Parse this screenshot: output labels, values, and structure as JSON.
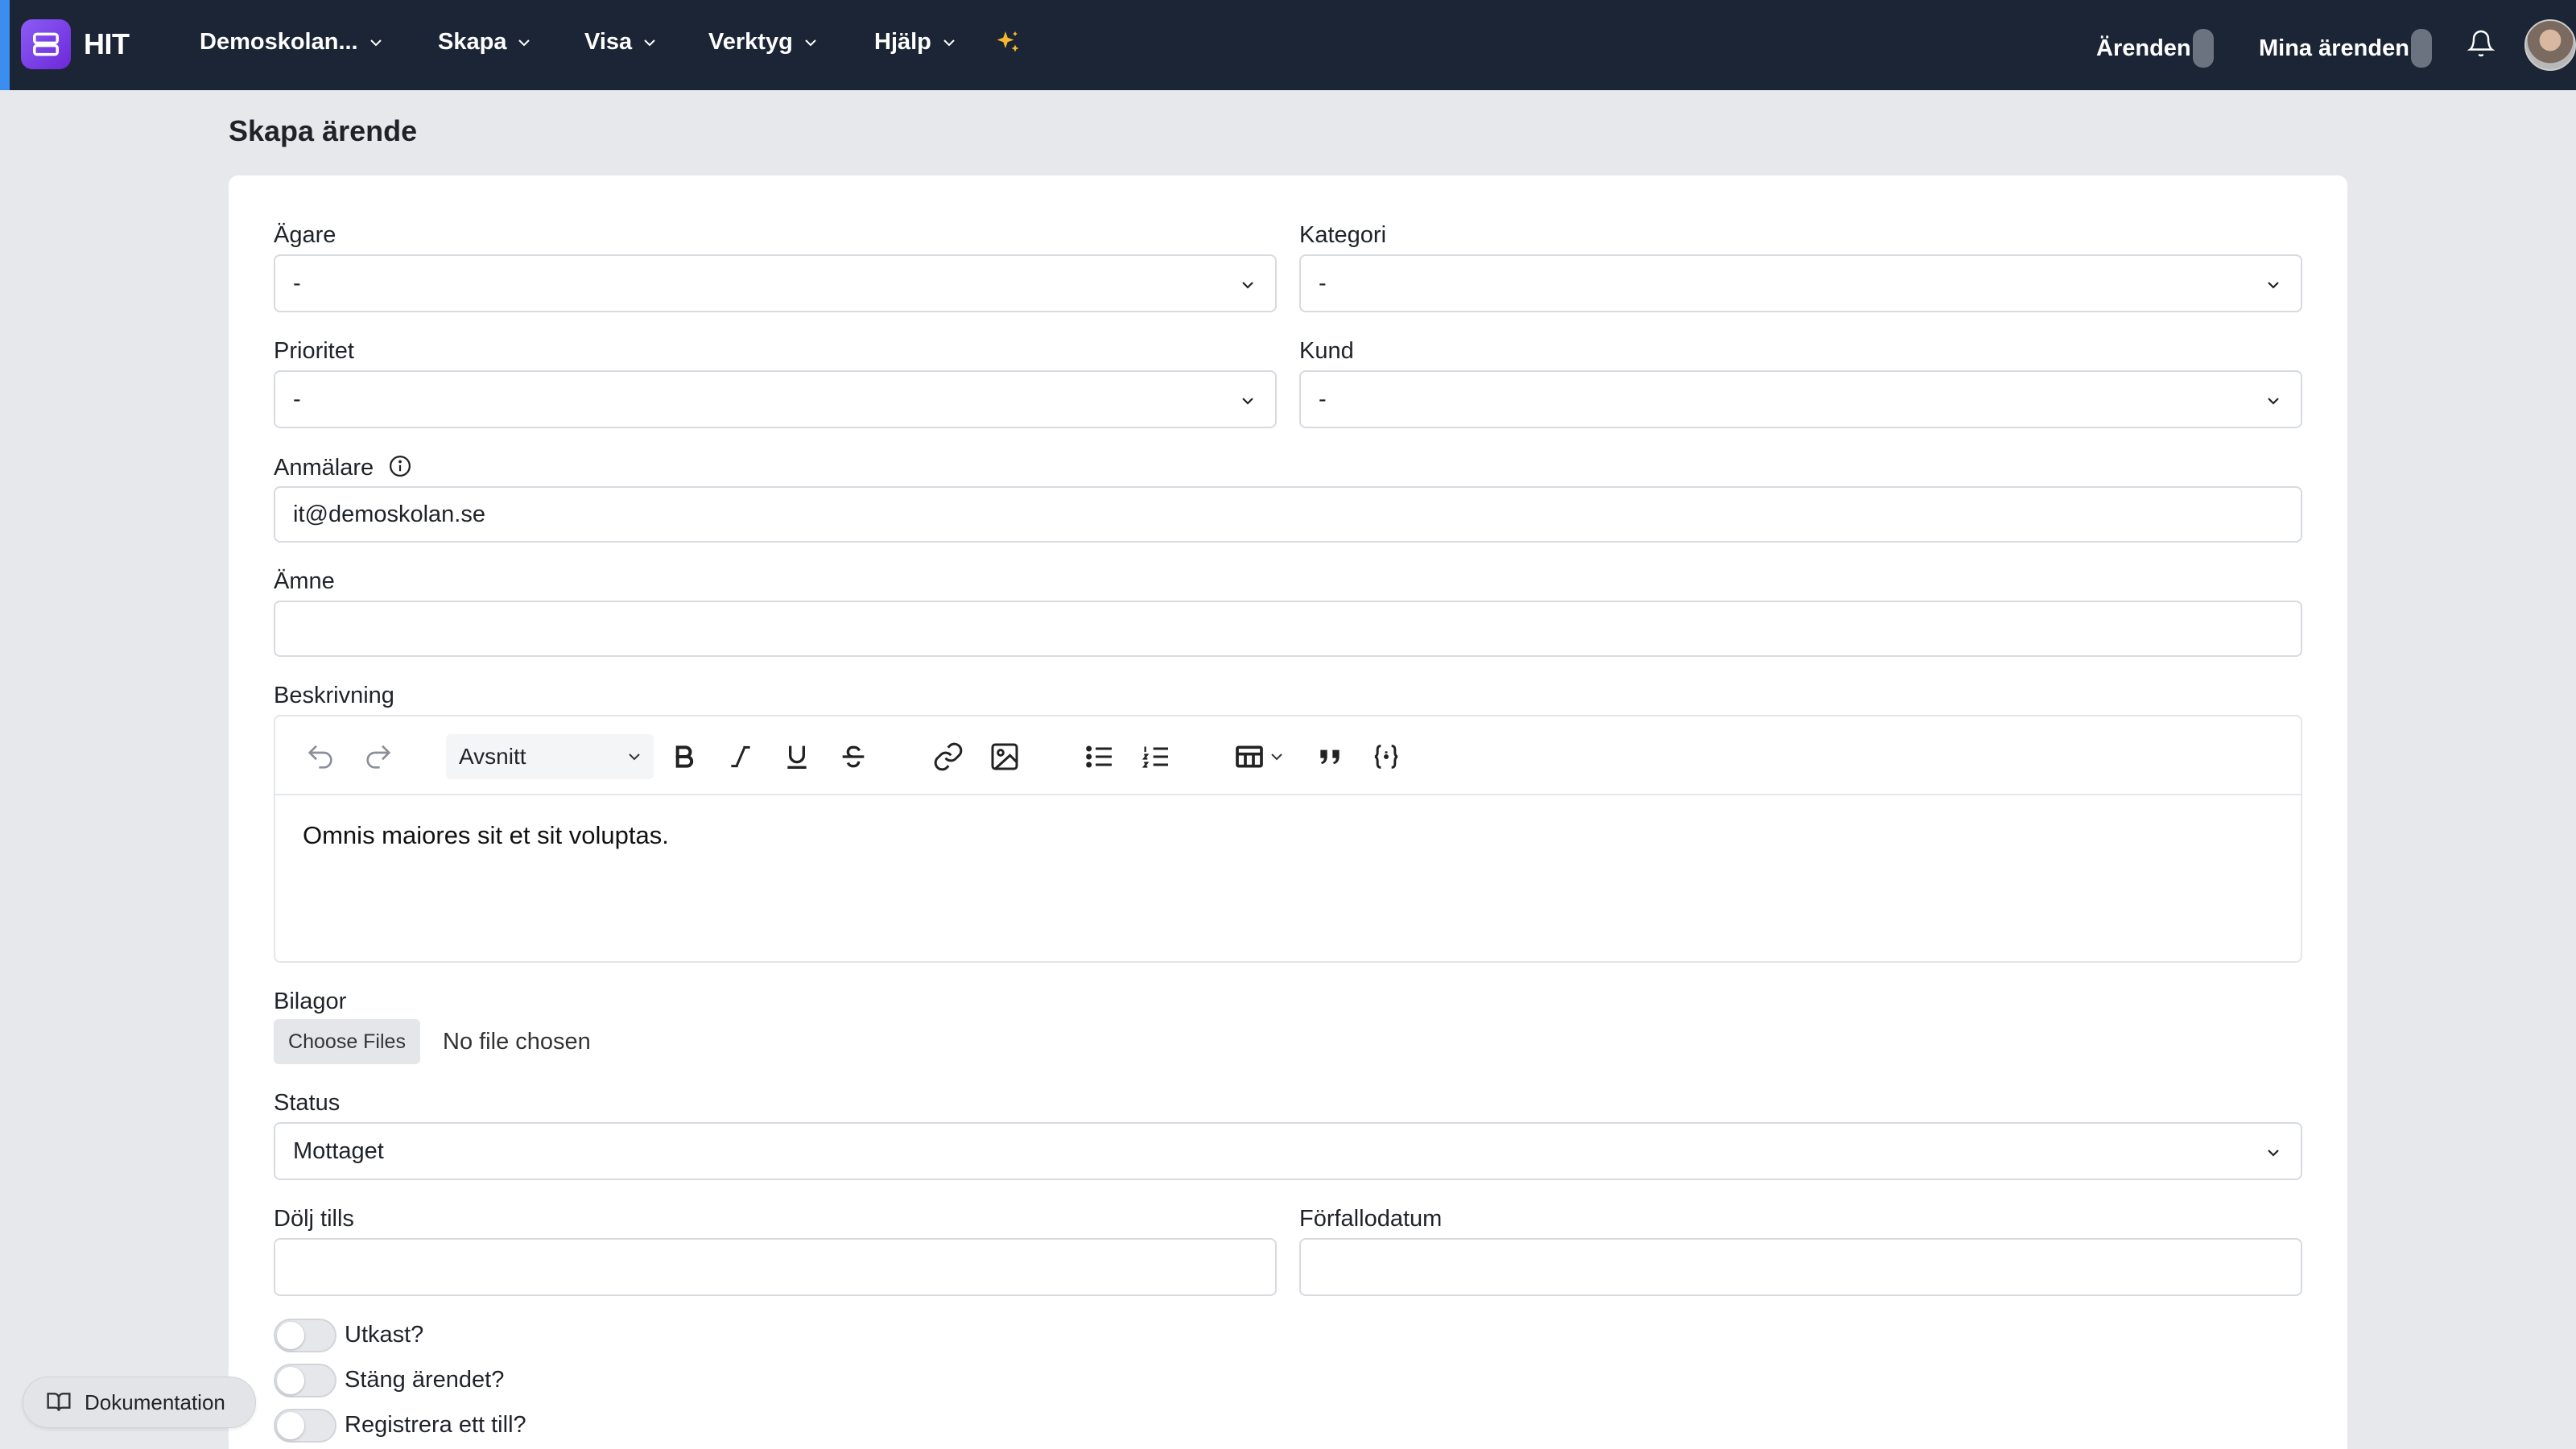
{
  "app": {
    "name": "HIT"
  },
  "nav": {
    "items": [
      {
        "label": "Demoskolan..."
      },
      {
        "label": "Skapa"
      },
      {
        "label": "Visa"
      },
      {
        "label": "Verktyg"
      },
      {
        "label": "Hjälp"
      }
    ],
    "tickets_label": "Ärenden",
    "my_tickets_label": "Mina ärenden"
  },
  "page": {
    "title": "Skapa ärende"
  },
  "form": {
    "owner": {
      "label": "Ägare",
      "value": "-"
    },
    "category": {
      "label": "Kategori",
      "value": "-"
    },
    "priority": {
      "label": "Prioritet",
      "value": "-"
    },
    "customer": {
      "label": "Kund",
      "value": "-"
    },
    "reporter": {
      "label": "Anmälare",
      "value": "it@demoskolan.se"
    },
    "subject": {
      "label": "Ämne",
      "value": ""
    },
    "description": {
      "label": "Beskrivning",
      "format": "Avsnitt",
      "text": "Omnis maiores sit et sit voluptas."
    },
    "attachments": {
      "label": "Bilagor",
      "button": "Choose Files",
      "status": "No file chosen"
    },
    "status": {
      "label": "Status",
      "value": "Mottaget"
    },
    "hide_until": {
      "label": "Dölj tills",
      "value": ""
    },
    "due_date": {
      "label": "Förfallodatum",
      "value": ""
    },
    "toggles": [
      {
        "label": "Utkast?",
        "on": false
      },
      {
        "label": "Stäng ärendet?",
        "on": false
      },
      {
        "label": "Registrera ett till?",
        "on": false
      }
    ]
  },
  "footer": {
    "docs_label": "Dokumentation"
  },
  "colors": {
    "topbar": "#1b2535",
    "accent": "#3b8ef0",
    "logo": "#7c3aed",
    "sparkle": "#f5b82e"
  }
}
